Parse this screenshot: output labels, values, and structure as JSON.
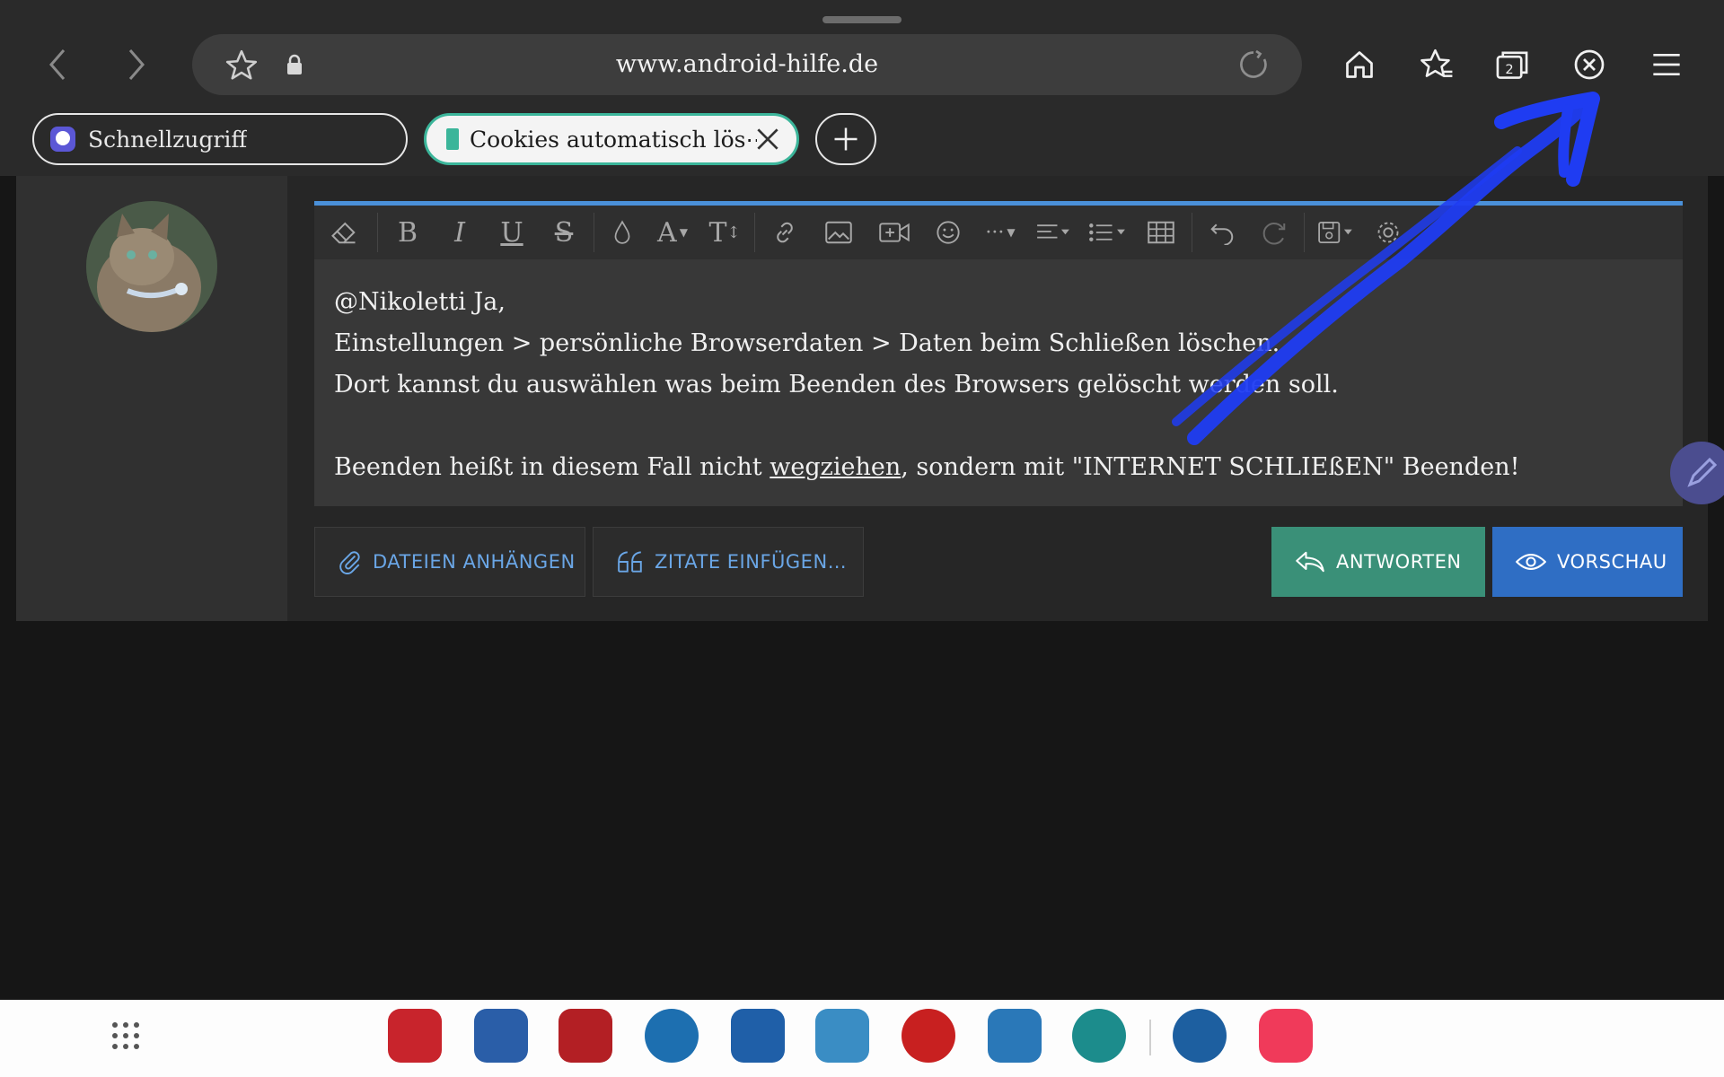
{
  "browser": {
    "url": "www.android-hilfe.de",
    "tabs": [
      {
        "label": "Schnellzugriff"
      },
      {
        "label": "Cookies automatisch lös⋯"
      }
    ]
  },
  "editor": {
    "lines": [
      "@Nikoletti Ja,",
      "Einstellungen > persönliche Browserdaten > Daten beim Schließen löschen.",
      "Dort kannst du auswählen was beim Beenden des Browsers gelöscht werden soll."
    ],
    "last_line_before": "Beenden heißt in diesem Fall nicht ",
    "last_line_underlined": "wegziehen",
    "last_line_after": ", sondern mit \"INTERNET SCHLIEßEN\" Beenden!"
  },
  "buttons": {
    "attach": "DATEIEN ANHÄNGEN",
    "quote": "ZITATE EINFÜGEN…",
    "reply": "ANTWORTEN",
    "preview": "VORSCHAU"
  },
  "colors": {
    "accent_teal": "#3a9078",
    "accent_blue": "#2f6ec4",
    "annotation": "#1f3cf2"
  }
}
